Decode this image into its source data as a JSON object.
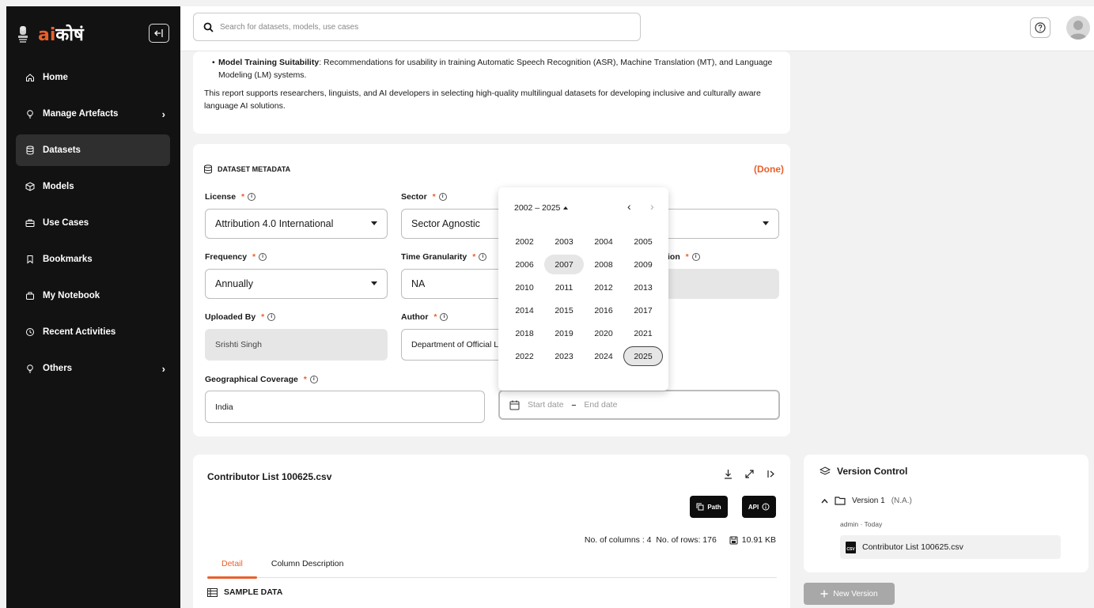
{
  "brand": {
    "ai": "ai",
    "kosh": "कोषं"
  },
  "sidebar": {
    "items": [
      {
        "label": "Home",
        "icon": "home-icon",
        "active": false
      },
      {
        "label": "Manage Artefacts",
        "icon": "bulb-icon",
        "active": false,
        "has_children": true
      },
      {
        "label": "Datasets",
        "icon": "database-icon",
        "active": true
      },
      {
        "label": "Models",
        "icon": "cube-icon",
        "active": false
      },
      {
        "label": "Use Cases",
        "icon": "briefcase-icon",
        "active": false
      },
      {
        "label": "Bookmarks",
        "icon": "bookmark-icon",
        "active": false
      },
      {
        "label": "My Notebook",
        "icon": "notebook-icon",
        "active": false
      },
      {
        "label": "Recent Activities",
        "icon": "clock-icon",
        "active": false
      },
      {
        "label": "Others",
        "icon": "bulb-icon",
        "active": false,
        "has_children": true
      }
    ]
  },
  "search": {
    "placeholder": "Search for datasets, models, use cases"
  },
  "description": {
    "bullet_bold": "Model Training Suitability",
    "bullet_text": ": Recommendations for usability in training Automatic Speech Recognition (ASR), Machine Translation (MT), and Language Modeling (LM) systems.",
    "paragraph": "This report supports researchers, linguists, and AI developers in selecting high-quality multilingual datasets for developing inclusive and culturally aware language AI solutions."
  },
  "metadata": {
    "title": "DATASET METADATA",
    "status": "(Done)",
    "fields": {
      "license": {
        "label": "License",
        "value": "Attribution 4.0 International"
      },
      "sector": {
        "label": "Sector",
        "value": "Sector Agnostic"
      },
      "frequency": {
        "label": "Frequency",
        "value": "Annually"
      },
      "time_granularity": {
        "label": "Time Granularity",
        "value": "NA"
      },
      "hidden_field": {
        "label_suffix": "ion"
      },
      "uploaded_by": {
        "label": "Uploaded By",
        "value": "Srishti Singh"
      },
      "author": {
        "label": "Author",
        "value": "Department of Official L"
      },
      "geo": {
        "label": "Geographical Coverage",
        "value": "India"
      },
      "date_range": {
        "start_placeholder": "Start date",
        "separator": "–",
        "end_placeholder": "End date"
      }
    },
    "required_mark": "*",
    "info_glyph": "i"
  },
  "year_picker": {
    "range_label": "2002 – 2025",
    "prev": "‹",
    "next": "›",
    "years": [
      "2002",
      "2003",
      "2004",
      "2005",
      "2006",
      "2007",
      "2008",
      "2009",
      "2010",
      "2011",
      "2012",
      "2013",
      "2014",
      "2015",
      "2016",
      "2017",
      "2018",
      "2019",
      "2020",
      "2021",
      "2022",
      "2023",
      "2024",
      "2025"
    ],
    "hovered": "2007",
    "selected": "2025"
  },
  "file": {
    "name": "Contributor List 100625.csv",
    "path_label": "Path",
    "api_label": "API",
    "columns_text": "No. of columns : 4",
    "rows_text": "No. of rows: 176",
    "size": "10.91 KB",
    "tabs": [
      "Detail",
      "Column Description"
    ],
    "sample_heading": "SAMPLE DATA"
  },
  "version_control": {
    "title": "Version Control",
    "version_label": "Version 1",
    "version_note": "(N.A.)",
    "meta": "admin · Today",
    "file_name": "Contributor List 100625.csv",
    "csv_badge": "CSV",
    "new_version_label": "New Version"
  },
  "colors": {
    "accent": "#e8602c",
    "sidebar_bg": "#121212",
    "page_bg": "#f2f2f2"
  }
}
